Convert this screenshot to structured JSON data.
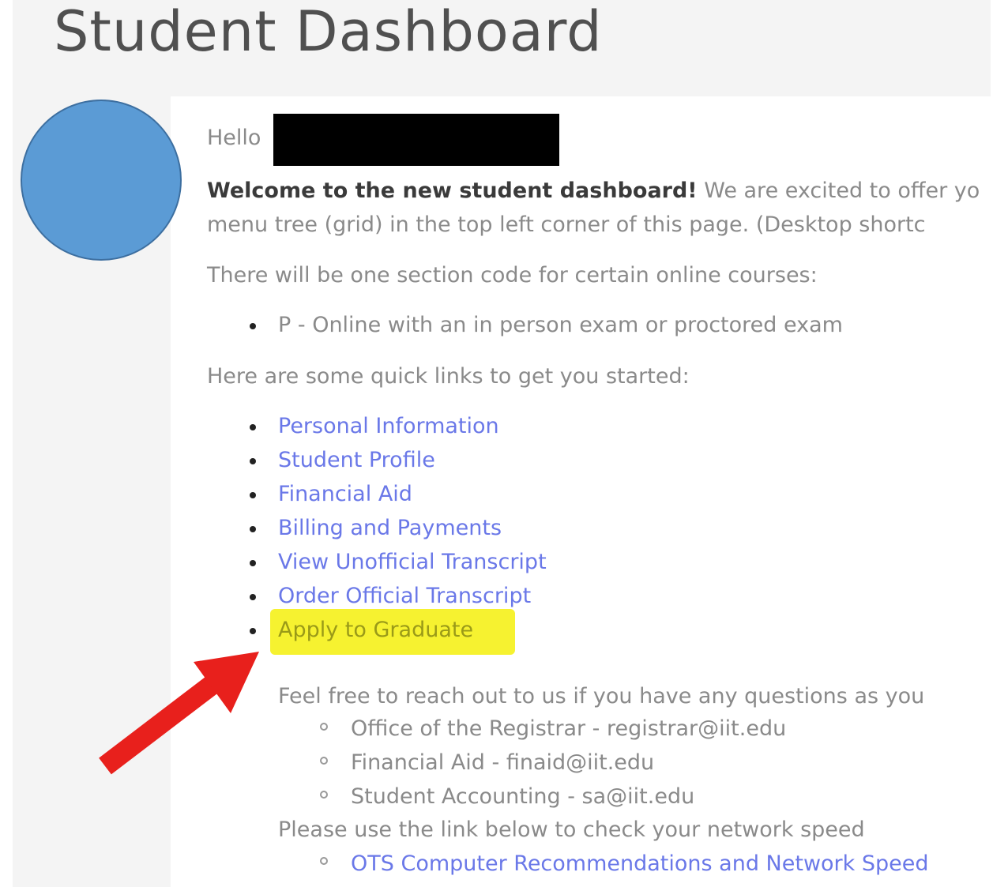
{
  "page": {
    "title": "Student Dashboard"
  },
  "greeting": {
    "hello": "Hello"
  },
  "welcome": {
    "bold": "Welcome to the new student dashboard!",
    "rest": " We are excited to offer yo",
    "line2": "menu tree (grid) in the top left corner of this page. (Desktop shortc"
  },
  "section_code": {
    "text": "There will be one section code for certain online courses:",
    "items": [
      "P - Online with an in person exam or proctored exam"
    ]
  },
  "quick_links": {
    "intro": "Here are some quick links to get you started:",
    "items": [
      "Personal Information",
      "Student Profile",
      "Financial Aid",
      "Billing and Payments",
      "View Unofficial Transcript",
      "Order Official Transcript",
      "Apply to Graduate"
    ]
  },
  "contact": {
    "intro": "Feel free to reach out to us if you have any questions as you",
    "items": [
      "Office of the Registrar - registrar@iit.edu",
      "Financial Aid - finaid@iit.edu",
      "Student Accounting - sa@iit.edu"
    ]
  },
  "network": {
    "intro": "Please use the link below to check your network speed",
    "link": "OTS Computer Recommendations and Network Speed"
  },
  "colors": {
    "avatar": "#5b9bd5",
    "link": "#6a78e8",
    "highlight": "#f6f230",
    "arrow": "#e8201c"
  }
}
